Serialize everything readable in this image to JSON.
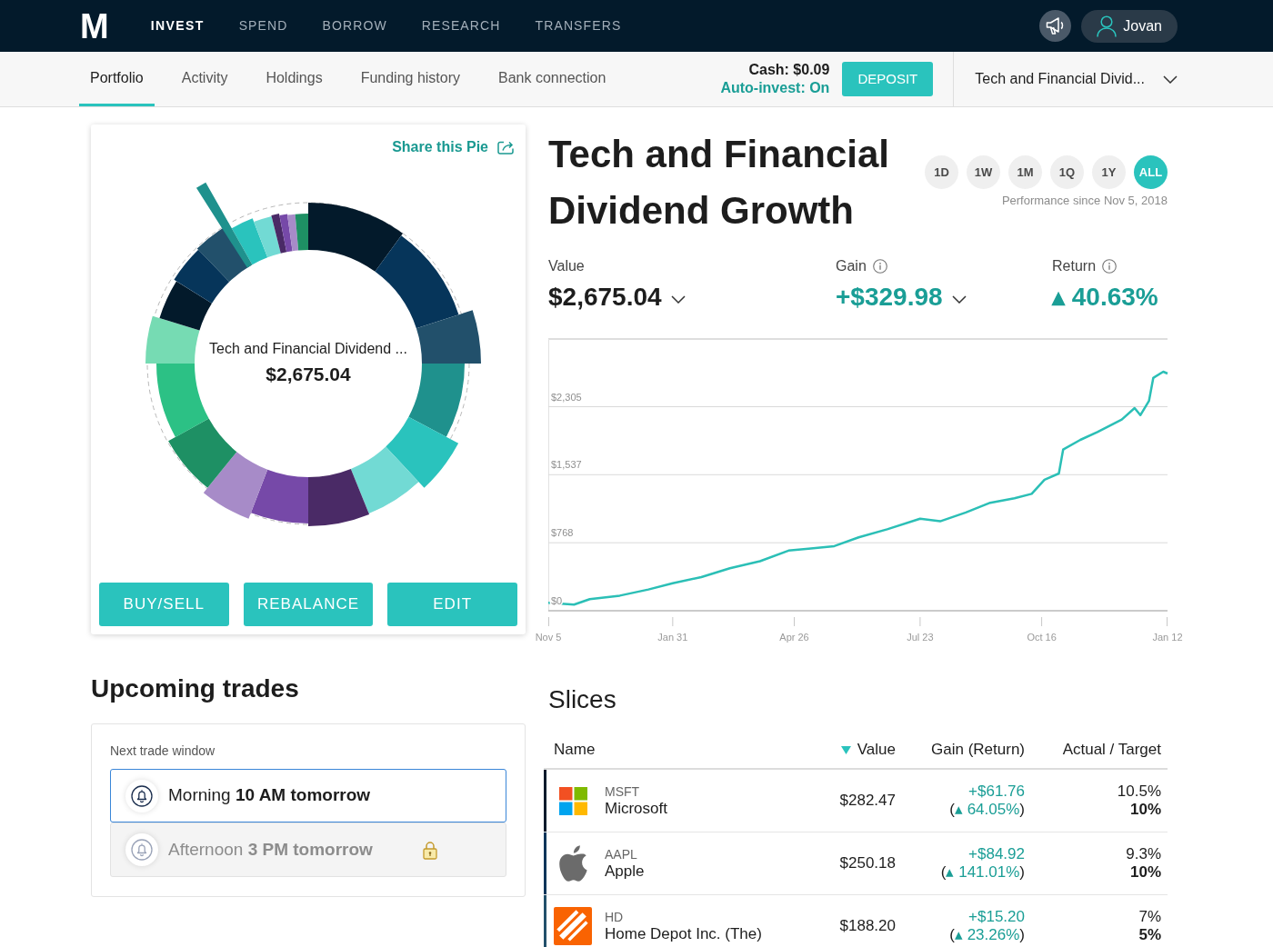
{
  "top_nav": {
    "logo": "M",
    "items": [
      {
        "label": "INVEST",
        "selected": true
      },
      {
        "label": "SPEND",
        "selected": false
      },
      {
        "label": "BORROW",
        "selected": false
      },
      {
        "label": "RESEARCH",
        "selected": false
      },
      {
        "label": "TRANSFERS",
        "selected": false
      }
    ],
    "user": "Jovan"
  },
  "sub_nav": {
    "tabs": [
      {
        "label": "Portfolio",
        "selected": true
      },
      {
        "label": "Activity",
        "selected": false
      },
      {
        "label": "Holdings",
        "selected": false
      },
      {
        "label": "Funding history",
        "selected": false
      },
      {
        "label": "Bank connection",
        "selected": false
      }
    ],
    "cash": "Cash: $0.09",
    "auto_invest": "Auto-invest: On",
    "deposit": "DEPOSIT",
    "pie_selector": "Tech and Financial Divid..."
  },
  "pie_card": {
    "share": "Share this Pie",
    "center_title": "Tech and Financial Dividend ...",
    "center_value": "$2,675.04",
    "buttons": [
      "BUY/SELL",
      "REBALANCE",
      "EDIT"
    ]
  },
  "pie_detail": {
    "title": "Tech and Financial Dividend Growth",
    "ranges": [
      {
        "label": "1D",
        "selected": false
      },
      {
        "label": "1W",
        "selected": false
      },
      {
        "label": "1M",
        "selected": false
      },
      {
        "label": "1Q",
        "selected": false
      },
      {
        "label": "1Y",
        "selected": false
      },
      {
        "label": "ALL",
        "selected": true
      }
    ],
    "performance_since": "Performance since Nov 5, 2018",
    "stats": [
      {
        "label": "Value",
        "value": "$2,675.04",
        "kind": "neutral",
        "info": false,
        "dropdown": true
      },
      {
        "label": "Gain",
        "value": "+$329.98",
        "kind": "positive",
        "info": true,
        "dropdown": true
      },
      {
        "label": "Return",
        "value": "▴ 40.63%",
        "kind": "positive",
        "info": true,
        "dropdown": false
      }
    ],
    "chart_data": [
      {
        "type": "line",
        "x": [
          "2018-11-05",
          "2018-11-23",
          "2018-12-04",
          "2018-12-25",
          "2019-01-14",
          "2019-01-31",
          "2019-02-20",
          "2019-03-12",
          "2019-04-02",
          "2019-04-22",
          "2019-05-06",
          "2019-05-24",
          "2019-06-10",
          "2019-06-30",
          "2019-07-23",
          "2019-08-06",
          "2019-08-24",
          "2019-09-10",
          "2019-09-27",
          "2019-10-09",
          "2019-10-18",
          "2019-10-28",
          "2019-10-31",
          "2019-11-12",
          "2019-11-24",
          "2019-12-11",
          "2019-12-20",
          "2019-12-24",
          "2019-12-30",
          "2020-01-02",
          "2020-01-09",
          "2020-01-12"
        ],
        "values": [
          90,
          70,
          130,
          170,
          240,
          310,
          380,
          480,
          560,
          680,
          700,
          730,
          830,
          920,
          1040,
          1010,
          1110,
          1220,
          1270,
          1320,
          1480,
          1550,
          1820,
          1930,
          2020,
          2160,
          2290,
          2210,
          2370,
          2630,
          2700,
          2680
        ],
        "color": "#2bbfb6",
        "xlim": [
          "2018-11-05",
          "2020-01-12"
        ],
        "xticks": [
          {
            "value": "2018-11-05",
            "label": "Nov 5"
          },
          {
            "value": "2019-01-31",
            "label": "Jan 31"
          },
          {
            "value": "2019-04-26",
            "label": "Apr 26"
          },
          {
            "value": "2019-07-23",
            "label": "Jul 23"
          },
          {
            "value": "2019-10-16",
            "label": "Oct 16"
          },
          {
            "value": "2020-01-12",
            "label": "Jan 12"
          }
        ],
        "yticks": [
          {
            "value": 0,
            "label": "$0"
          },
          {
            "value": 768,
            "label": "$768"
          },
          {
            "value": 1537,
            "label": "$1,537"
          },
          {
            "value": 2305,
            "label": "$2,305"
          }
        ],
        "ylim": [
          0,
          3070
        ],
        "grid": true
      }
    ]
  },
  "upcoming_trades": {
    "title": "Upcoming trades",
    "label": "Next trade window",
    "windows": [
      {
        "text": "Morning **10 AM tomorrow**",
        "selected": true,
        "locked": false
      },
      {
        "text": "Afternoon **3 PM tomorrow**",
        "selected": false,
        "locked": true
      }
    ]
  },
  "slices": {
    "title": "Slices",
    "columns": [
      {
        "label": "Name",
        "sorted": false
      },
      {
        "label": "Value",
        "sorted": true
      },
      {
        "label": "Gain (Return)",
        "sorted": false
      },
      {
        "label": "Actual / Target",
        "sorted": false
      }
    ],
    "rows": [
      {
        "kind": "squares",
        "color": "#031a2b",
        "ticker": "MSFT",
        "name": "Microsoft",
        "value": "$282.47",
        "gain": "+$61.76",
        "return": "(▴ 64.05%)",
        "actual": "10.5%",
        "target": "10%"
      },
      {
        "kind": "apple",
        "color": "#06355a",
        "ticker": "AAPL",
        "name": "Apple",
        "value": "$250.18",
        "gain": "+$84.92",
        "return": "(▴ 141.01%)",
        "actual": "9.3%",
        "target": "10%"
      },
      {
        "kind": "stamp",
        "color": "#22506b",
        "ticker": "HD",
        "name": "Home Depot Inc. (The)",
        "value": "$188.20",
        "gain": "+$15.20",
        "return": "(▴ 23.26%)",
        "actual": "7%",
        "target": "5%"
      }
    ]
  }
}
